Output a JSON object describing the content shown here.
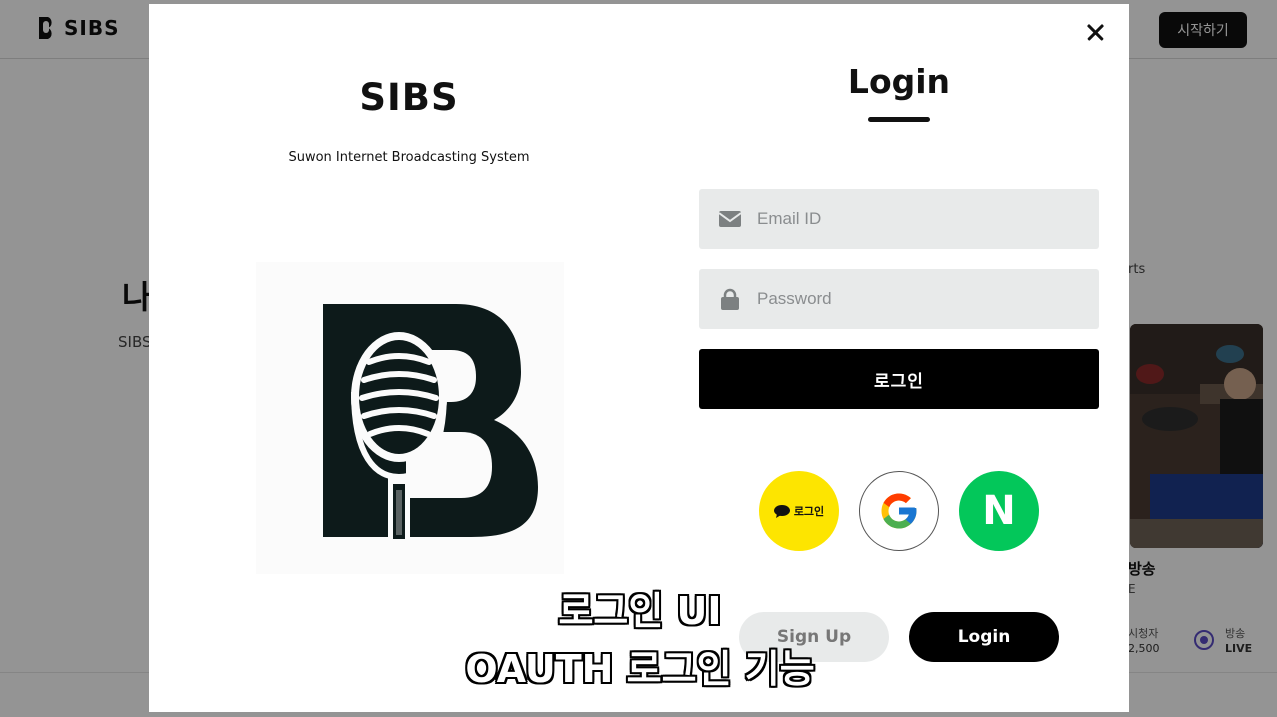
{
  "background": {
    "logo_text": "SIBS",
    "start_button": "시작하기",
    "hero_title_partial": "나",
    "hero_sub_partial": "SIBS",
    "shorts_partial": "rts",
    "stream_title_partial": "방송",
    "stream_sub_partial": "E",
    "viewers_label_partial": "시청자",
    "viewers_value_partial": "2,500",
    "live_label": "방송",
    "live_value": "LIVE"
  },
  "modal": {
    "brand_title": "SIBS",
    "brand_subtitle": "Suwon Internet Broadcasting System",
    "login_title": "Login",
    "email_placeholder": "Email ID",
    "password_placeholder": "Password",
    "submit_label": "로그인",
    "kakao_label": "로그인",
    "naver_letter": "N",
    "signup_label": "Sign Up",
    "login_label": "Login"
  },
  "caption": {
    "line1": "로그인 UI",
    "line2": "OAUTH 로그인 기능"
  },
  "colors": {
    "kakao": "#fde500",
    "naver": "#03c75a",
    "field_bg": "#e8eaea",
    "live_accent": "#5b4bc4"
  },
  "icons": [
    "close-icon",
    "envelope-icon",
    "lock-icon",
    "kakao-chat-icon",
    "google-icon",
    "naver-icon",
    "microphone-logo",
    "live-icon"
  ]
}
